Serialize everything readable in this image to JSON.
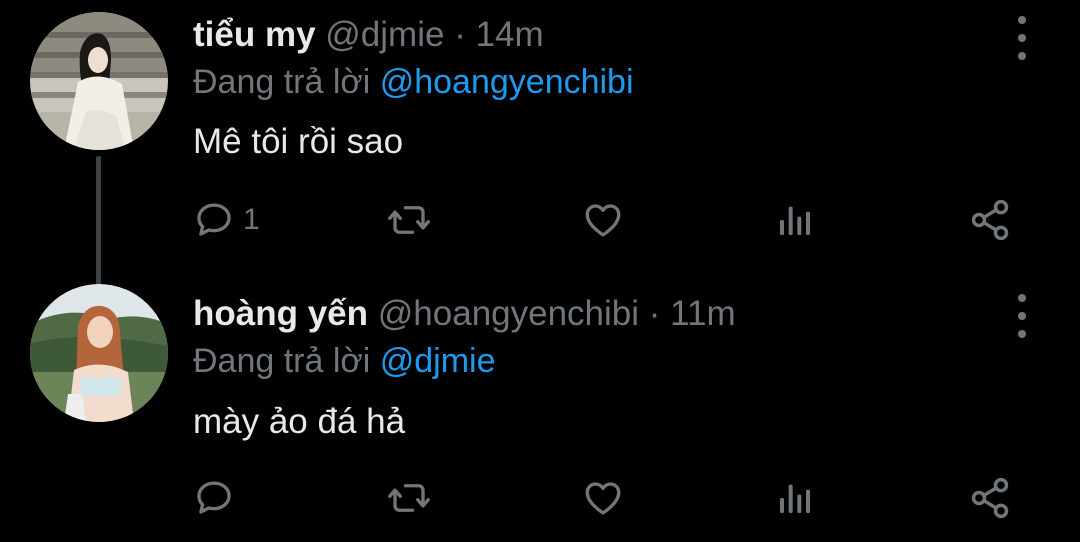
{
  "tweets": [
    {
      "name": "tiểu my",
      "handle": "@djmie",
      "separator": "·",
      "time": "14m",
      "replying_prefix": "Đang trả lời",
      "replying_to": "@hoangyenchibi",
      "text": "Mê tôi rồi sao",
      "reply_count": "1",
      "avatar_icon": "user-avatar-photo"
    },
    {
      "name": "hoàng yến",
      "handle": "@hoangyenchibi",
      "separator": "·",
      "time": "11m",
      "replying_prefix": "Đang trả lời",
      "replying_to": "@djmie",
      "text": "mày ảo đá hả",
      "reply_count": "",
      "avatar_icon": "user-avatar-photo"
    }
  ],
  "icons": {
    "reply": "reply-bubble-icon",
    "retweet": "retweet-icon",
    "like": "heart-icon",
    "stats": "analytics-icon",
    "share": "share-icon",
    "more": "more-options-icon"
  },
  "colors": {
    "background": "#000000",
    "primary_text": "#e7e9ea",
    "secondary_text": "#71767b",
    "link": "#1d9bf0",
    "thread_line": "#3e4144"
  }
}
